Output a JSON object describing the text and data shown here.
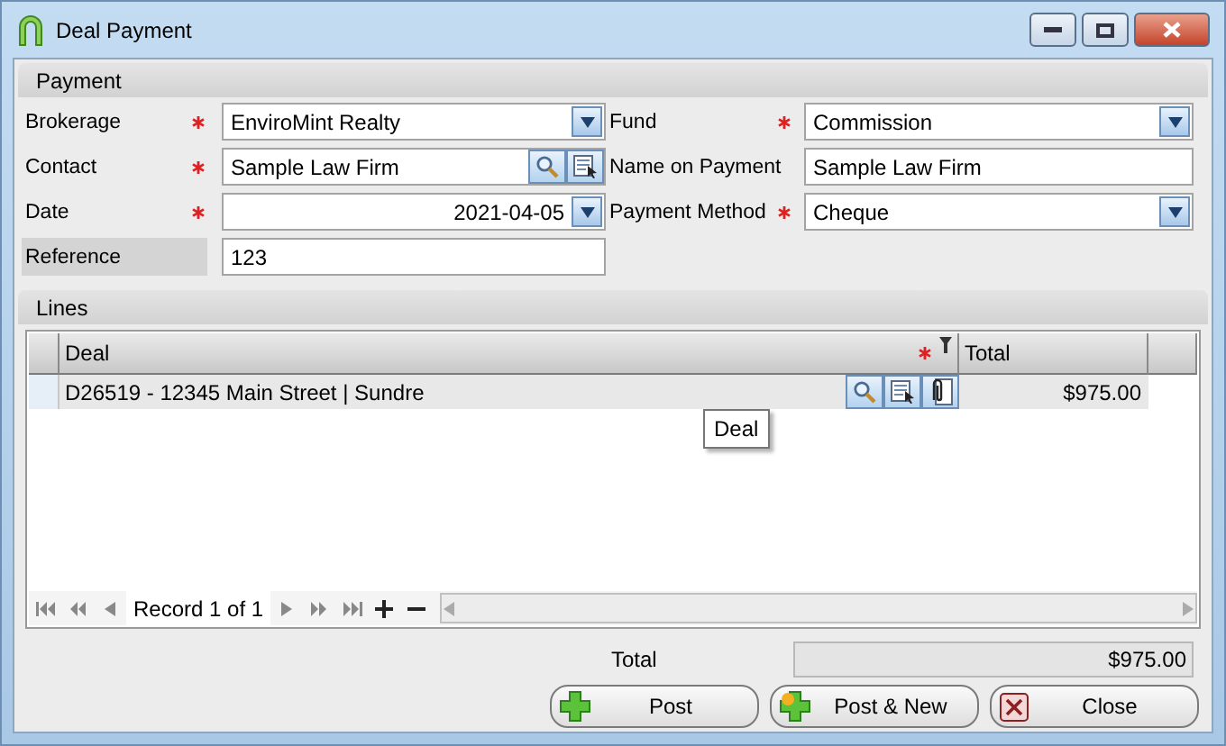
{
  "window": {
    "title": "Deal Payment"
  },
  "payment": {
    "title": "Payment",
    "rows": [
      {
        "left": {
          "label": "Brokerage",
          "required": true,
          "shaded": false,
          "kind": "combo",
          "value": "EnviroMint Realty"
        },
        "right": {
          "label": "Fund",
          "required": true,
          "shaded": false,
          "kind": "combo",
          "value": "Commission"
        }
      },
      {
        "left": {
          "label": "Contact",
          "required": true,
          "shaded": false,
          "kind": "lookup",
          "value": "Sample Law Firm"
        },
        "right": {
          "label": "Name on Payment",
          "required": false,
          "shaded": false,
          "kind": "text",
          "value": "Sample Law Firm"
        }
      },
      {
        "left": {
          "label": "Date",
          "required": true,
          "shaded": false,
          "kind": "date",
          "value": "2021-04-05"
        },
        "right": {
          "label": "Payment Method",
          "required": true,
          "shaded": false,
          "kind": "combo",
          "value": "Cheque"
        }
      },
      {
        "left": {
          "label": "Reference",
          "required": false,
          "shaded": true,
          "kind": "text",
          "value": "123"
        }
      }
    ]
  },
  "lines": {
    "title": "Lines",
    "columns": [
      {
        "label": "Deal",
        "required": true,
        "filter": true
      },
      {
        "label": "Total",
        "required": false,
        "filter": false
      }
    ],
    "rows": [
      {
        "deal": "D26519 - 12345 Main Street | Sundre",
        "total": "$975.00"
      }
    ],
    "tooltip": "Deal",
    "record": "Record 1 of 1"
  },
  "total": {
    "label": "Total",
    "value": "$975.00"
  },
  "buttons": [
    {
      "label": "Post",
      "kind": "post"
    },
    {
      "label": "Post & New",
      "kind": "post-new"
    },
    {
      "label": "Close",
      "kind": "close"
    }
  ]
}
